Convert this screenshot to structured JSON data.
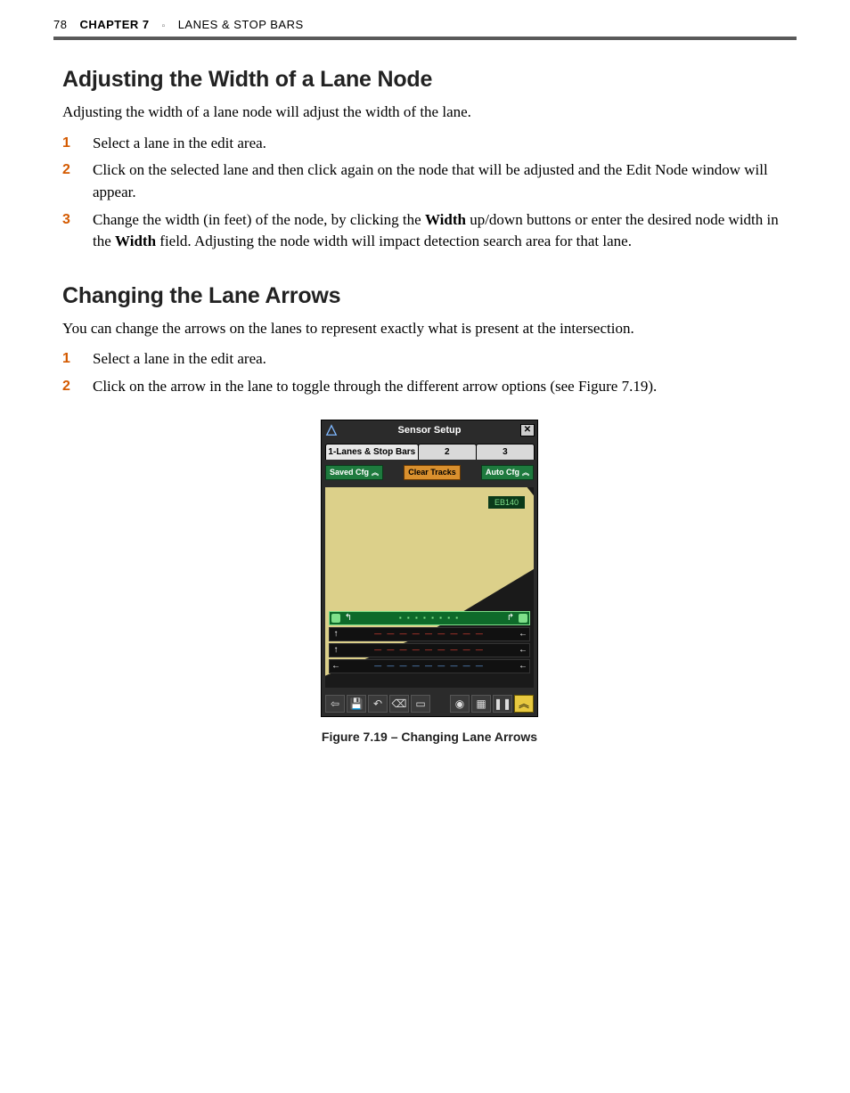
{
  "page": {
    "number": "78",
    "chapter_label": "CHAPTER 7",
    "chapter_title": "LANES & STOP BARS"
  },
  "section_a": {
    "heading": "Adjusting the Width of a Lane Node",
    "intro": "Adjusting the width of a lane node will adjust the width of the lane.",
    "steps": {
      "s1": "Select a lane in the edit area.",
      "s2": "Click on the selected lane and then click again on the node that will be adjusted and the Edit Node window will appear.",
      "s3_a": "Change the width (in feet) of the node, by clicking the ",
      "s3_b1": "Width",
      "s3_c": " up/down buttons or enter the desired node width in the ",
      "s3_b2": "Width",
      "s3_d": " field. Adjusting the node width will impact detection search area for that lane."
    }
  },
  "section_b": {
    "heading": "Changing the Lane Arrows",
    "intro": "You can change the arrows on the lanes to represent exactly what is present at the intersection.",
    "steps": {
      "s1": "Select a lane in the edit area.",
      "s2": "Click on the arrow in the lane to toggle through the different arrow options (see Figure 7.19)."
    }
  },
  "figure": {
    "caption": "Figure 7.19 – Changing Lane Arrows",
    "window_title": "Sensor Setup",
    "tabs": {
      "t1": "1-Lanes & Stop Bars",
      "t2": "2",
      "t3": "3"
    },
    "buttons": {
      "saved": "Saved Cfg",
      "clear": "Clear Tracks",
      "auto": "Auto Cfg"
    },
    "badge": "EB140",
    "close": "✕",
    "toolbar_icons": {
      "back": "⇦",
      "save": "💾",
      "undo": "↶",
      "erase": "⌫",
      "folder": "▭",
      "view": "◉",
      "grid": "▦",
      "pause": "❚❚",
      "collapse": "︽"
    },
    "arrows": {
      "up": "↑",
      "upleft": "↰",
      "left": "←",
      "upright": "↱"
    },
    "caret": "︽"
  }
}
